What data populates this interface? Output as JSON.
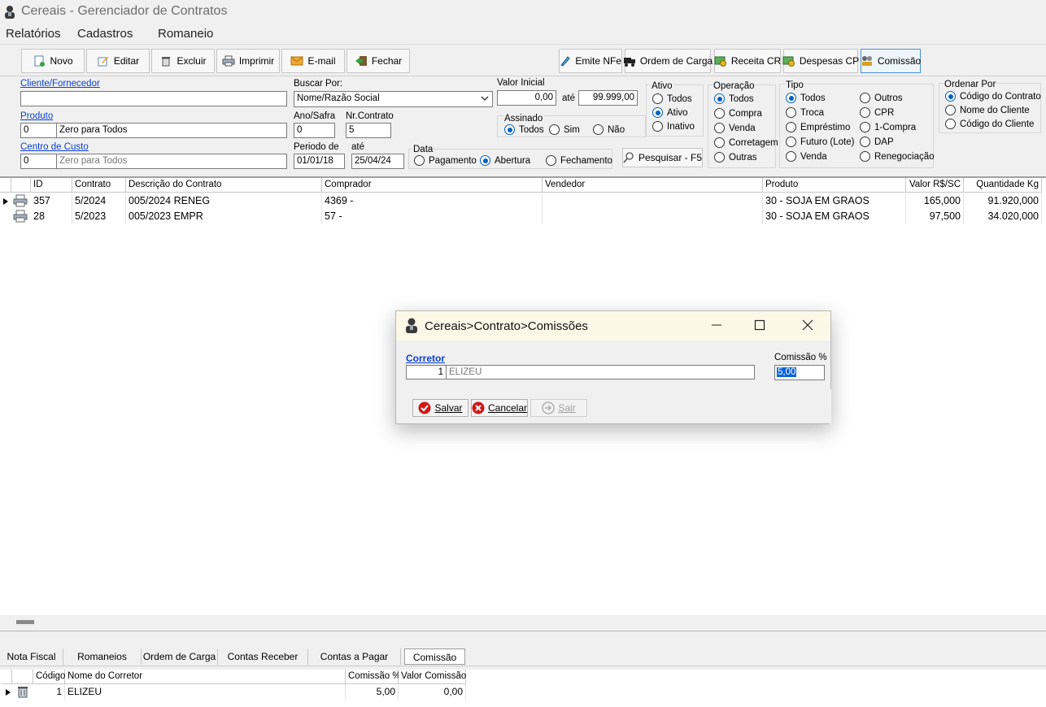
{
  "window": {
    "title": "Cereais - Gerenciador de Contratos"
  },
  "menu": [
    "Relatórios",
    "Cadastros",
    "Romaneio"
  ],
  "toolbar": {
    "left": [
      {
        "label": "Novo",
        "icon": "new-doc-icon"
      },
      {
        "label": "Editar",
        "icon": "edit-icon"
      },
      {
        "label": "Excluir",
        "icon": "trash-icon"
      },
      {
        "label": "Imprimir",
        "icon": "printer-icon"
      },
      {
        "label": "E-mail",
        "icon": "envelope-icon"
      },
      {
        "label": "Fechar",
        "icon": "exit-icon"
      }
    ],
    "right": [
      {
        "label": "Emite NFe",
        "icon": "pen-icon"
      },
      {
        "label": "Ordem de Carga",
        "icon": "truck-icon"
      },
      {
        "label": "Receita CR",
        "icon": "money-icon"
      },
      {
        "label": "Despesas CP",
        "icon": "money-icon"
      },
      {
        "label": "Comissão",
        "icon": "commission-icon"
      }
    ]
  },
  "filters": {
    "cliente_label": "Cliente/Fornecedor",
    "cliente_value": "",
    "produto_label": "Produto",
    "produto_code": "0",
    "produto_name": "Zero para Todos",
    "centro_label": "Centro de Custo",
    "centro_code": "0",
    "centro_placeholder": "Zero para Todos",
    "buscar_label": "Buscar Por:",
    "buscar_value": "Nome/Razão Social",
    "ano_label": "Ano/Safra",
    "ano_value": "0",
    "nr_label": "Nr.Contrato",
    "nr_value": "5",
    "periodo_label": "Periodo de",
    "periodo_de": "01/01/18",
    "ate_label": "até",
    "periodo_ate": "25/04/24",
    "valor_label": "Valor Inicial",
    "valor_de": "0,00",
    "valor_ate": "99.999,00",
    "assinado_label": "Assinado",
    "assinado_options": [
      "Todos",
      "Sim",
      "Não"
    ],
    "data_label": "Data",
    "data_options": [
      "Pagamento",
      "Abertura",
      "Fechamento"
    ],
    "pesquisar_label": "Pesquisar - F5",
    "ativo_label": "Ativo",
    "ativo_options": [
      "Todos",
      "Ativo",
      "Inativo"
    ],
    "operacao_label": "Operação",
    "operacao_options": [
      "Todos",
      "Compra",
      "Venda",
      "Corretagem",
      "Outras"
    ],
    "tipo_label": "Tipo",
    "tipo_col1": [
      "Todos",
      "Troca",
      "Empréstimo",
      "Futuro (Lote)",
      "Venda"
    ],
    "tipo_col2": [
      "Outros",
      "CPR",
      "1-Compra",
      "DAP",
      "Renegociação"
    ],
    "ordenar_label": "Ordenar Por",
    "ordenar_options": [
      "Código do Contrato",
      "Nome do Cliente",
      "Código do Cliente"
    ]
  },
  "grid": {
    "columns": [
      "ID",
      "Contrato",
      "Descrição do Contrato",
      "Comprador",
      "Vendedor",
      "Produto",
      "Valor R$/SC",
      "Quantidade Kg"
    ],
    "rows": [
      [
        "357",
        "5/2024",
        "005/2024 RENEG",
        "4369 -",
        "",
        "30 - SOJA EM GRAOS",
        "165,000",
        "91.920,000"
      ],
      [
        "28",
        "5/2023",
        "005/2023 EMPR",
        "57 -",
        "",
        "30 - SOJA EM GRAOS",
        "97,500",
        "34.020,000"
      ]
    ]
  },
  "tabs": [
    "Nota Fiscal",
    "Romaneios",
    "Ordem de Carga",
    "Contas Receber",
    "Contas a Pagar",
    "Comissão"
  ],
  "subgrid": {
    "columns": [
      "Código",
      "Nome do Corretor",
      "Comissão %",
      "Valor Comissão"
    ],
    "rows": [
      [
        "1",
        "ELIZEU",
        "5,00",
        "0,00"
      ]
    ]
  },
  "dialog": {
    "title": "Cereais>Contrato>Comissões",
    "corretor_label": "Corretor",
    "corretor_code": "1",
    "corretor_name": "ELIZEU",
    "comissao_label": "Comissão %",
    "comissao_value": "5,00",
    "salvar": "Salvar",
    "cancelar": "Cancelar",
    "sair": "Sair"
  },
  "colors": {
    "link": "#0a3fd1",
    "radio": "#0060c0",
    "dialog_title_bg": "#fbf8e7"
  }
}
